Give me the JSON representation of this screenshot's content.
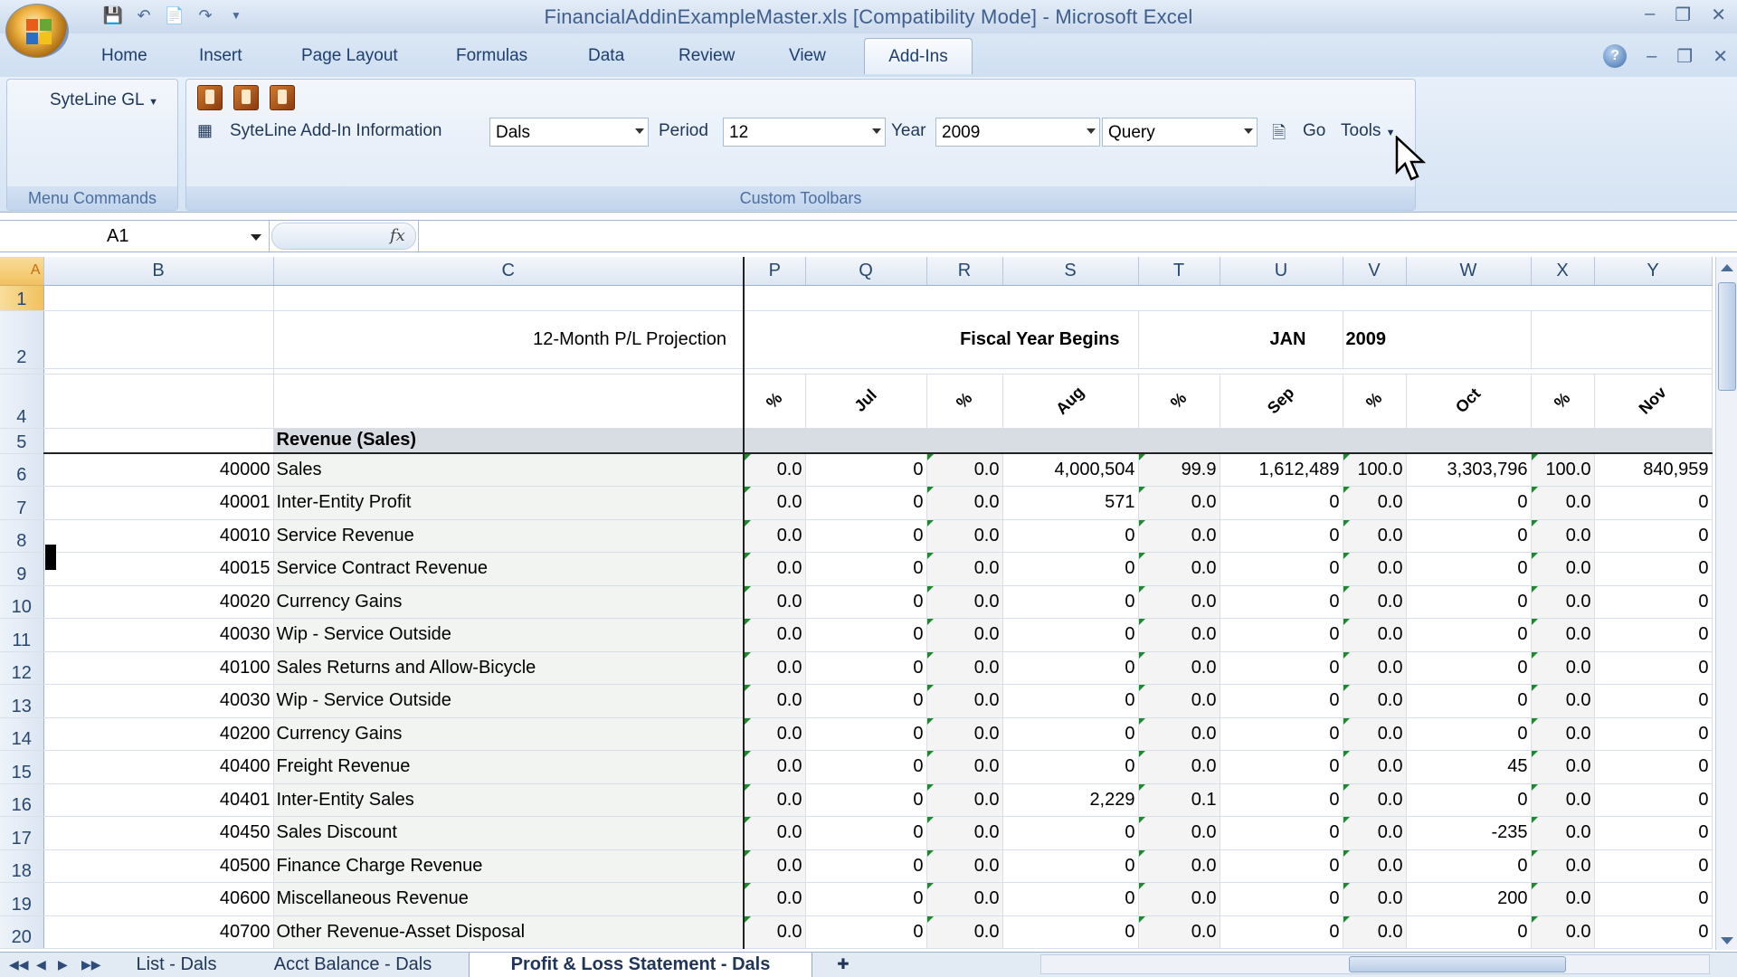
{
  "window": {
    "title": "FinancialAddinExampleMaster.xls  [Compatibility Mode] - Microsoft Excel"
  },
  "ribbon_tabs": [
    "Home",
    "Insert",
    "Page Layout",
    "Formulas",
    "Data",
    "Review",
    "View",
    "Add-Ins"
  ],
  "active_tab": "Add-Ins",
  "menu_commands": {
    "syteline_gl": "SyteLine GL",
    "group_label": "Menu Commands"
  },
  "custom_toolbars": {
    "info_label": "SyteLine Add-In Information",
    "entity_value": "Dals",
    "period_label": "Period",
    "period_value": "12",
    "year_label": "Year",
    "year_value": "2009",
    "query_value": "Query",
    "go_label": "Go",
    "tools_label": "Tools",
    "group_label": "Custom Toolbars"
  },
  "formula_bar": {
    "name_box": "A1",
    "fx": "fx",
    "formula": ""
  },
  "columns": [
    "B",
    "C",
    "P",
    "Q",
    "R",
    "S",
    "T",
    "U",
    "V",
    "W",
    "X",
    "Y"
  ],
  "sheet": {
    "title": "12-Month P/L Projection",
    "fiscal_label": "Fiscal Year Begins",
    "fiscal_month": "JAN",
    "fiscal_year": "2009",
    "month_headers": [
      "%",
      "Jul",
      "%",
      "Aug",
      "%",
      "Sep",
      "%",
      "Oct",
      "%",
      "Nov"
    ],
    "section_header": "Revenue (Sales)",
    "rows": [
      {
        "n": "6",
        "acct": "40000",
        "desc": "Sales",
        "v": [
          "0.0",
          "0",
          "0.0",
          "4,000,504",
          "99.9",
          "1,612,489",
          "100.0",
          "3,303,796",
          "100.0",
          "840,959"
        ]
      },
      {
        "n": "7",
        "acct": "40001",
        "desc": "Inter-Entity Profit",
        "v": [
          "0.0",
          "0",
          "0.0",
          "571",
          "0.0",
          "0",
          "0.0",
          "0",
          "0.0",
          "0"
        ]
      },
      {
        "n": "8",
        "acct": "40010",
        "desc": "Service Revenue",
        "v": [
          "0.0",
          "0",
          "0.0",
          "0",
          "0.0",
          "0",
          "0.0",
          "0",
          "0.0",
          "0"
        ]
      },
      {
        "n": "9",
        "acct": "40015",
        "desc": "Service Contract Revenue",
        "v": [
          "0.0",
          "0",
          "0.0",
          "0",
          "0.0",
          "0",
          "0.0",
          "0",
          "0.0",
          "0"
        ]
      },
      {
        "n": "10",
        "acct": "40020",
        "desc": "Currency Gains",
        "v": [
          "0.0",
          "0",
          "0.0",
          "0",
          "0.0",
          "0",
          "0.0",
          "0",
          "0.0",
          "0"
        ]
      },
      {
        "n": "11",
        "acct": "40030",
        "desc": "Wip - Service Outside",
        "v": [
          "0.0",
          "0",
          "0.0",
          "0",
          "0.0",
          "0",
          "0.0",
          "0",
          "0.0",
          "0"
        ]
      },
      {
        "n": "12",
        "acct": "40100",
        "desc": "Sales Returns and Allow-Bicycle",
        "v": [
          "0.0",
          "0",
          "0.0",
          "0",
          "0.0",
          "0",
          "0.0",
          "0",
          "0.0",
          "0"
        ]
      },
      {
        "n": "13",
        "acct": "40030",
        "desc": "Wip - Service Outside",
        "v": [
          "0.0",
          "0",
          "0.0",
          "0",
          "0.0",
          "0",
          "0.0",
          "0",
          "0.0",
          "0"
        ]
      },
      {
        "n": "14",
        "acct": "40200",
        "desc": "Currency Gains",
        "v": [
          "0.0",
          "0",
          "0.0",
          "0",
          "0.0",
          "0",
          "0.0",
          "0",
          "0.0",
          "0"
        ]
      },
      {
        "n": "15",
        "acct": "40400",
        "desc": "Freight Revenue",
        "v": [
          "0.0",
          "0",
          "0.0",
          "0",
          "0.0",
          "0",
          "0.0",
          "45",
          "0.0",
          "0"
        ]
      },
      {
        "n": "16",
        "acct": "40401",
        "desc": "Inter-Entity Sales",
        "v": [
          "0.0",
          "0",
          "0.0",
          "2,229",
          "0.1",
          "0",
          "0.0",
          "0",
          "0.0",
          "0"
        ]
      },
      {
        "n": "17",
        "acct": "40450",
        "desc": "Sales Discount",
        "v": [
          "0.0",
          "0",
          "0.0",
          "0",
          "0.0",
          "0",
          "0.0",
          "-235",
          "0.0",
          "0"
        ]
      },
      {
        "n": "18",
        "acct": "40500",
        "desc": "Finance Charge Revenue",
        "v": [
          "0.0",
          "0",
          "0.0",
          "0",
          "0.0",
          "0",
          "0.0",
          "0",
          "0.0",
          "0"
        ]
      },
      {
        "n": "19",
        "acct": "40600",
        "desc": "Miscellaneous Revenue",
        "v": [
          "0.0",
          "0",
          "0.0",
          "0",
          "0.0",
          "0",
          "0.0",
          "200",
          "0.0",
          "0"
        ]
      },
      {
        "n": "20",
        "acct": "40700",
        "desc": "Other Revenue-Asset Disposal",
        "v": [
          "0.0",
          "0",
          "0.0",
          "0",
          "0.0",
          "0",
          "0.0",
          "0",
          "0.0",
          "0"
        ]
      }
    ]
  },
  "sheet_tabs": [
    "List - Dals",
    "Acct Balance - Dals",
    "Profit & Loss Statement - Dals"
  ],
  "active_sheet": "Profit & Loss Statement - Dals",
  "colors": {
    "accent": "#1e3e6e",
    "ribbon_bg": "#d5e3f3",
    "green_marker": "#1a8a2a"
  }
}
